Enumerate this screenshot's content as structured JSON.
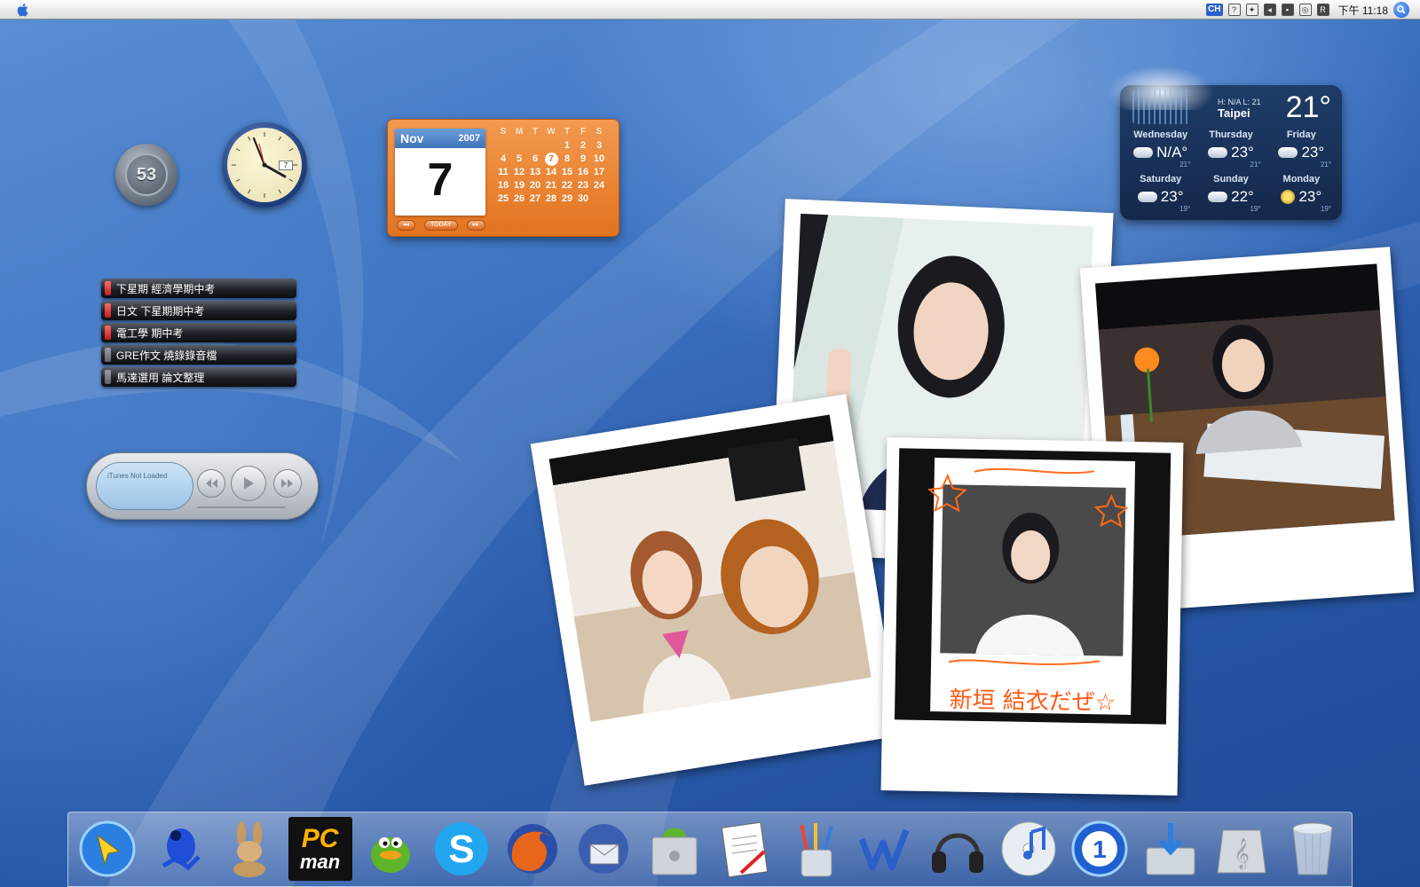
{
  "menubar": {
    "input_method": "CH",
    "clock": "下午 11:18"
  },
  "widgets": {
    "cpu_gauge": {
      "value": "53"
    },
    "analog_clock": {
      "date_window": "7"
    },
    "calendar": {
      "month": "Nov",
      "year": "2007",
      "day": "7",
      "weekdays": [
        "S",
        "M",
        "T",
        "W",
        "T",
        "F",
        "S"
      ],
      "buttons": {
        "prev": "◂◂",
        "today": "TODAY",
        "next": "▸▸"
      }
    },
    "todo": {
      "items": [
        {
          "label": "下星期 經濟學期中考",
          "tag": "red"
        },
        {
          "label": "日文 下星期期中考",
          "tag": "red"
        },
        {
          "label": "電工學 期中考",
          "tag": "red"
        },
        {
          "label": "GRE作文 燒錄錄音檔",
          "tag": "gray"
        },
        {
          "label": "馬達選用 論文整理",
          "tag": "gray"
        }
      ]
    },
    "itunes": {
      "status": "iTunes Not Loaded"
    },
    "weather": {
      "hilo": "H: N/A  L: 21",
      "city": "Taipei",
      "temp": "21°",
      "forecast": [
        {
          "day": "Wednesday",
          "hi": "N/A°",
          "lo": "21°"
        },
        {
          "day": "Thursday",
          "hi": "23°",
          "lo": "21°"
        },
        {
          "day": "Friday",
          "hi": "23°",
          "lo": "21°"
        },
        {
          "day": "Saturday",
          "hi": "23°",
          "lo": "19°"
        },
        {
          "day": "Sunday",
          "hi": "22°",
          "lo": "19°"
        },
        {
          "day": "Monday",
          "hi": "23°",
          "lo": "19°"
        }
      ]
    },
    "polaroid_caption": "新垣 結衣だぜ☆"
  },
  "dock": {
    "items": [
      "Finder",
      "Frog App",
      "Rabbit App",
      "PC man",
      "Duck Messenger",
      "Skype",
      "Firefox",
      "Thunderbird",
      "Mac Disk",
      "Rich Text",
      "Pencil Cup",
      "Word",
      "Headphones",
      "iTunes",
      "Update",
      "Downloads",
      "Music",
      "Recycle Bin"
    ],
    "pcman": {
      "line1": "PC",
      "line2": "man"
    }
  },
  "colors": {
    "desktop": "#2a5aa5",
    "calendar": "#e3731f",
    "weather": "#1f3d68",
    "dock": "#9ab5e0"
  }
}
